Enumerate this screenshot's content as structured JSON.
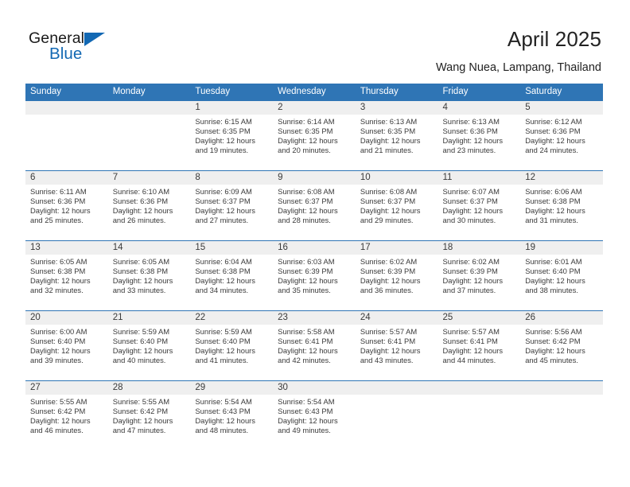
{
  "brand": {
    "name_top": "General",
    "name_bottom": "Blue",
    "accent_color": "#1268b3"
  },
  "header": {
    "title": "April 2025",
    "subtitle": "Wang Nuea, Lampang, Thailand"
  },
  "theme": {
    "header_row_bg": "#2f75b5",
    "date_bar_bg": "#efefef",
    "text_color": "#3a3a3a"
  },
  "day_names": [
    "Sunday",
    "Monday",
    "Tuesday",
    "Wednesday",
    "Thursday",
    "Friday",
    "Saturday"
  ],
  "weeks": [
    [
      {
        "day": "",
        "lines": []
      },
      {
        "day": "",
        "lines": []
      },
      {
        "day": "1",
        "lines": [
          "Sunrise: 6:15 AM",
          "Sunset: 6:35 PM",
          "Daylight: 12 hours",
          "and 19 minutes."
        ]
      },
      {
        "day": "2",
        "lines": [
          "Sunrise: 6:14 AM",
          "Sunset: 6:35 PM",
          "Daylight: 12 hours",
          "and 20 minutes."
        ]
      },
      {
        "day": "3",
        "lines": [
          "Sunrise: 6:13 AM",
          "Sunset: 6:35 PM",
          "Daylight: 12 hours",
          "and 21 minutes."
        ]
      },
      {
        "day": "4",
        "lines": [
          "Sunrise: 6:13 AM",
          "Sunset: 6:36 PM",
          "Daylight: 12 hours",
          "and 23 minutes."
        ]
      },
      {
        "day": "5",
        "lines": [
          "Sunrise: 6:12 AM",
          "Sunset: 6:36 PM",
          "Daylight: 12 hours",
          "and 24 minutes."
        ]
      }
    ],
    [
      {
        "day": "6",
        "lines": [
          "Sunrise: 6:11 AM",
          "Sunset: 6:36 PM",
          "Daylight: 12 hours",
          "and 25 minutes."
        ]
      },
      {
        "day": "7",
        "lines": [
          "Sunrise: 6:10 AM",
          "Sunset: 6:36 PM",
          "Daylight: 12 hours",
          "and 26 minutes."
        ]
      },
      {
        "day": "8",
        "lines": [
          "Sunrise: 6:09 AM",
          "Sunset: 6:37 PM",
          "Daylight: 12 hours",
          "and 27 minutes."
        ]
      },
      {
        "day": "9",
        "lines": [
          "Sunrise: 6:08 AM",
          "Sunset: 6:37 PM",
          "Daylight: 12 hours",
          "and 28 minutes."
        ]
      },
      {
        "day": "10",
        "lines": [
          "Sunrise: 6:08 AM",
          "Sunset: 6:37 PM",
          "Daylight: 12 hours",
          "and 29 minutes."
        ]
      },
      {
        "day": "11",
        "lines": [
          "Sunrise: 6:07 AM",
          "Sunset: 6:37 PM",
          "Daylight: 12 hours",
          "and 30 minutes."
        ]
      },
      {
        "day": "12",
        "lines": [
          "Sunrise: 6:06 AM",
          "Sunset: 6:38 PM",
          "Daylight: 12 hours",
          "and 31 minutes."
        ]
      }
    ],
    [
      {
        "day": "13",
        "lines": [
          "Sunrise: 6:05 AM",
          "Sunset: 6:38 PM",
          "Daylight: 12 hours",
          "and 32 minutes."
        ]
      },
      {
        "day": "14",
        "lines": [
          "Sunrise: 6:05 AM",
          "Sunset: 6:38 PM",
          "Daylight: 12 hours",
          "and 33 minutes."
        ]
      },
      {
        "day": "15",
        "lines": [
          "Sunrise: 6:04 AM",
          "Sunset: 6:38 PM",
          "Daylight: 12 hours",
          "and 34 minutes."
        ]
      },
      {
        "day": "16",
        "lines": [
          "Sunrise: 6:03 AM",
          "Sunset: 6:39 PM",
          "Daylight: 12 hours",
          "and 35 minutes."
        ]
      },
      {
        "day": "17",
        "lines": [
          "Sunrise: 6:02 AM",
          "Sunset: 6:39 PM",
          "Daylight: 12 hours",
          "and 36 minutes."
        ]
      },
      {
        "day": "18",
        "lines": [
          "Sunrise: 6:02 AM",
          "Sunset: 6:39 PM",
          "Daylight: 12 hours",
          "and 37 minutes."
        ]
      },
      {
        "day": "19",
        "lines": [
          "Sunrise: 6:01 AM",
          "Sunset: 6:40 PM",
          "Daylight: 12 hours",
          "and 38 minutes."
        ]
      }
    ],
    [
      {
        "day": "20",
        "lines": [
          "Sunrise: 6:00 AM",
          "Sunset: 6:40 PM",
          "Daylight: 12 hours",
          "and 39 minutes."
        ]
      },
      {
        "day": "21",
        "lines": [
          "Sunrise: 5:59 AM",
          "Sunset: 6:40 PM",
          "Daylight: 12 hours",
          "and 40 minutes."
        ]
      },
      {
        "day": "22",
        "lines": [
          "Sunrise: 5:59 AM",
          "Sunset: 6:40 PM",
          "Daylight: 12 hours",
          "and 41 minutes."
        ]
      },
      {
        "day": "23",
        "lines": [
          "Sunrise: 5:58 AM",
          "Sunset: 6:41 PM",
          "Daylight: 12 hours",
          "and 42 minutes."
        ]
      },
      {
        "day": "24",
        "lines": [
          "Sunrise: 5:57 AM",
          "Sunset: 6:41 PM",
          "Daylight: 12 hours",
          "and 43 minutes."
        ]
      },
      {
        "day": "25",
        "lines": [
          "Sunrise: 5:57 AM",
          "Sunset: 6:41 PM",
          "Daylight: 12 hours",
          "and 44 minutes."
        ]
      },
      {
        "day": "26",
        "lines": [
          "Sunrise: 5:56 AM",
          "Sunset: 6:42 PM",
          "Daylight: 12 hours",
          "and 45 minutes."
        ]
      }
    ],
    [
      {
        "day": "27",
        "lines": [
          "Sunrise: 5:55 AM",
          "Sunset: 6:42 PM",
          "Daylight: 12 hours",
          "and 46 minutes."
        ]
      },
      {
        "day": "28",
        "lines": [
          "Sunrise: 5:55 AM",
          "Sunset: 6:42 PM",
          "Daylight: 12 hours",
          "and 47 minutes."
        ]
      },
      {
        "day": "29",
        "lines": [
          "Sunrise: 5:54 AM",
          "Sunset: 6:43 PM",
          "Daylight: 12 hours",
          "and 48 minutes."
        ]
      },
      {
        "day": "30",
        "lines": [
          "Sunrise: 5:54 AM",
          "Sunset: 6:43 PM",
          "Daylight: 12 hours",
          "and 49 minutes."
        ]
      },
      {
        "day": "",
        "lines": []
      },
      {
        "day": "",
        "lines": []
      },
      {
        "day": "",
        "lines": []
      }
    ]
  ]
}
